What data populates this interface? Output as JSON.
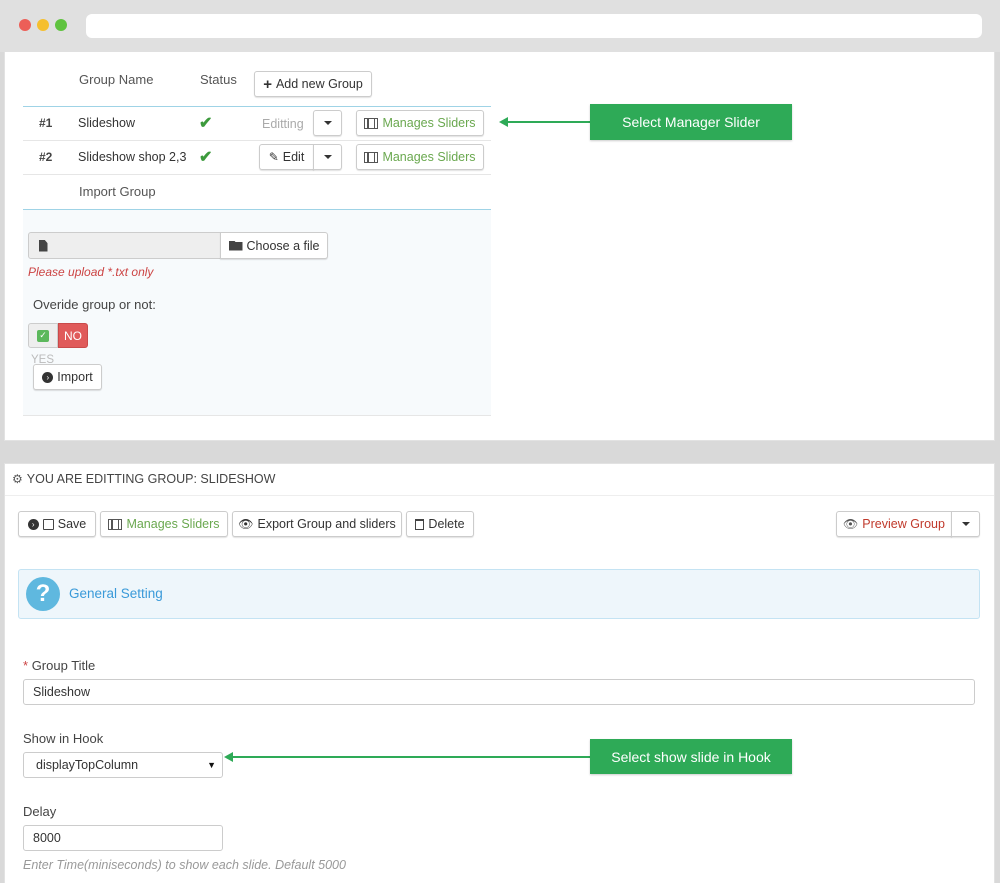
{
  "colors": {
    "accent_green": "#6aa84f",
    "callout_green": "#2eaa57",
    "error_red": "#cc4444",
    "no_red": "#e05a5a",
    "info_blue": "#3a9ad9"
  },
  "groups_table": {
    "headers": {
      "name": "Group Name",
      "status": "Status"
    },
    "add_button": "Add new Group",
    "rows": [
      {
        "num": "#1",
        "name": "Slideshow",
        "status_icon": "check-icon",
        "action": "Editting",
        "manage": "Manages Sliders"
      },
      {
        "num": "#2",
        "name": "Slideshow shop 2,3",
        "status_icon": "check-icon",
        "action": "Edit",
        "manage": "Manages Sliders"
      }
    ],
    "import_label": "Import Group"
  },
  "import": {
    "choose_file": "Choose a file",
    "hint": "Please upload *.txt only",
    "override_label": "Overide group or not:",
    "toggle_no": "NO",
    "toggle_yes": "YES",
    "import_button": "Import"
  },
  "callouts": {
    "manager": "Select Manager Slider",
    "hook": "Select show slide in Hook"
  },
  "edit_panel": {
    "title": "YOU ARE EDITTING GROUP: SLIDESHOW",
    "toolbar": {
      "save": "Save",
      "manage": "Manages Sliders",
      "export": "Export Group and sliders",
      "delete": "Delete",
      "preview": "Preview Group"
    },
    "general_setting": "General Setting",
    "fields": {
      "title_label": "Group Title",
      "title_value": "Slideshow",
      "hook_label": "Show in Hook",
      "hook_value": "displayTopColumn",
      "delay_label": "Delay",
      "delay_value": "8000",
      "delay_hint": "Enter Time(miniseconds) to show each slide. Default 5000"
    }
  }
}
